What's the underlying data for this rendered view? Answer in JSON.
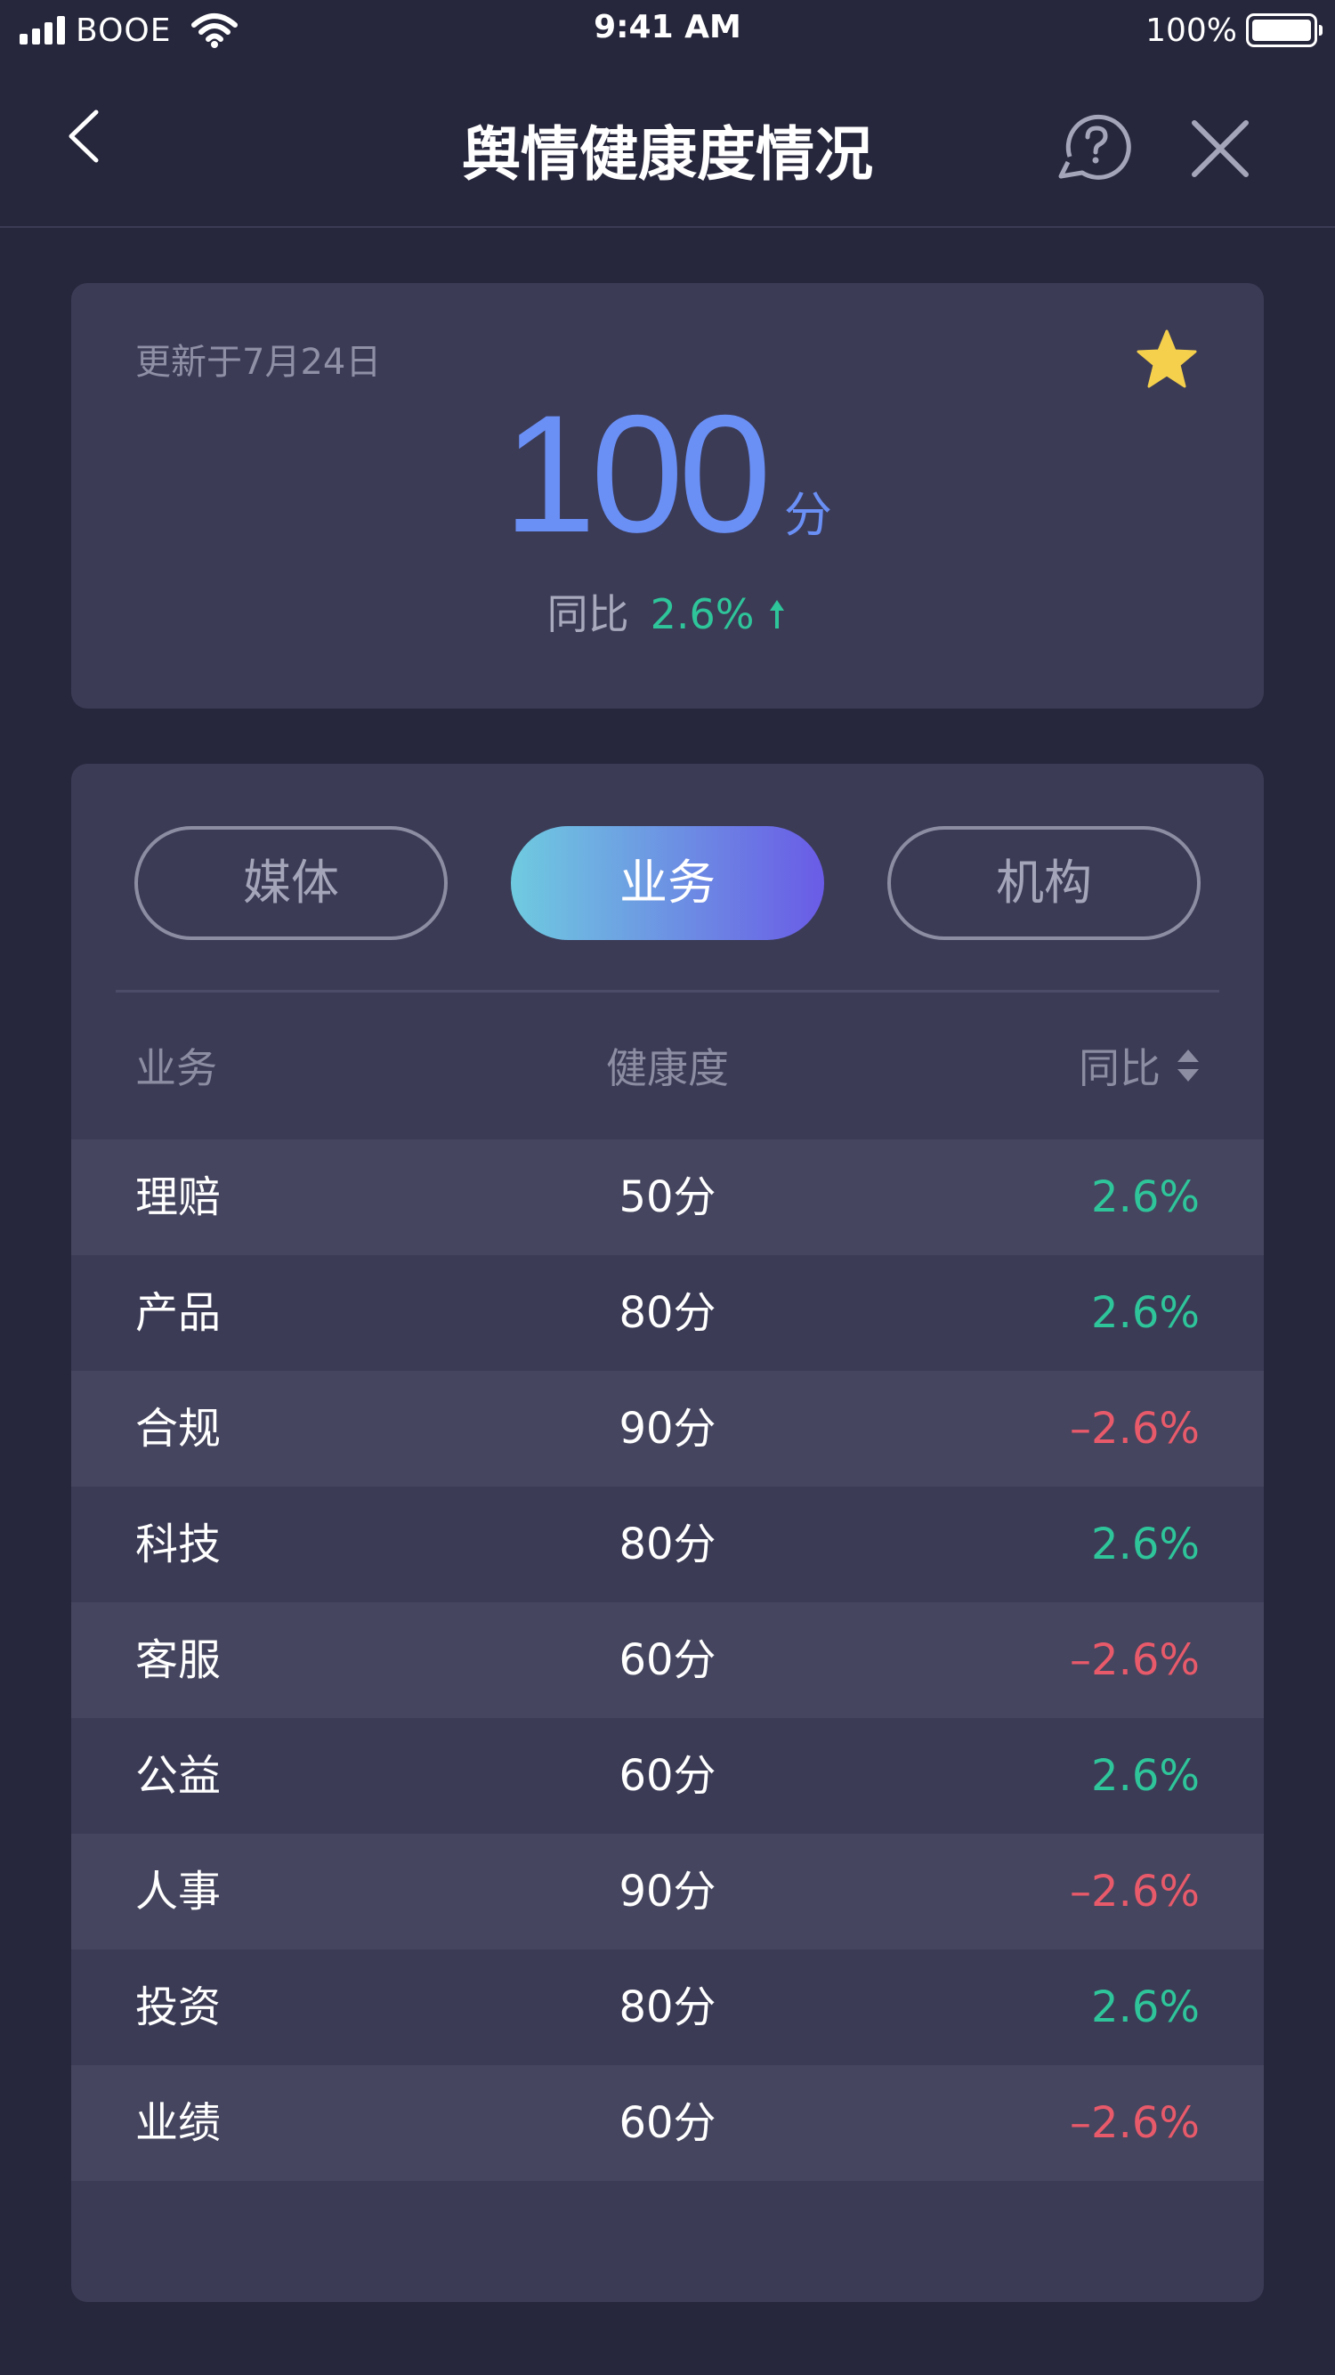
{
  "status_bar": {
    "carrier": "BOOE",
    "time": "9:41 AM",
    "battery": "100%"
  },
  "nav": {
    "title": "舆情健康度情况",
    "back_icon": "chevron-left-icon",
    "help_icon": "help-bubble-icon",
    "close_icon": "close-icon"
  },
  "summary": {
    "updated": "更新于7月24日",
    "score": "100",
    "unit": "分",
    "yoy_label": "同比",
    "yoy_value": "2.6%",
    "favorite_icon": "star-icon",
    "trend_icon": "arrow-up-icon"
  },
  "tabs": [
    {
      "label": "媒体",
      "active": false
    },
    {
      "label": "业务",
      "active": true
    },
    {
      "label": "机构",
      "active": false
    }
  ],
  "table": {
    "headers": {
      "name": "业务",
      "health": "健康度",
      "yoy": "同比"
    },
    "rows": [
      {
        "name": "理赔",
        "health": "50分",
        "yoy": "2.6%",
        "trend": "up"
      },
      {
        "name": "产品",
        "health": "80分",
        "yoy": "2.6%",
        "trend": "up"
      },
      {
        "name": "合规",
        "health": "90分",
        "yoy": "–2.6%",
        "trend": "down"
      },
      {
        "name": "科技",
        "health": "80分",
        "yoy": "2.6%",
        "trend": "up"
      },
      {
        "name": "客服",
        "health": "60分",
        "yoy": "–2.6%",
        "trend": "down"
      },
      {
        "name": "公益",
        "health": "60分",
        "yoy": "2.6%",
        "trend": "up"
      },
      {
        "name": "人事",
        "health": "90分",
        "yoy": "–2.6%",
        "trend": "down"
      },
      {
        "name": "投资",
        "health": "80分",
        "yoy": "2.6%",
        "trend": "up"
      },
      {
        "name": "业绩",
        "health": "60分",
        "yoy": "–2.6%",
        "trend": "down"
      }
    ]
  },
  "colors": {
    "background": "#26263c",
    "card": "#3b3b56",
    "accent_blue": "#6a8ff5",
    "positive": "#2fc59a",
    "negative": "#e85a6a",
    "star": "#f5d04d"
  }
}
